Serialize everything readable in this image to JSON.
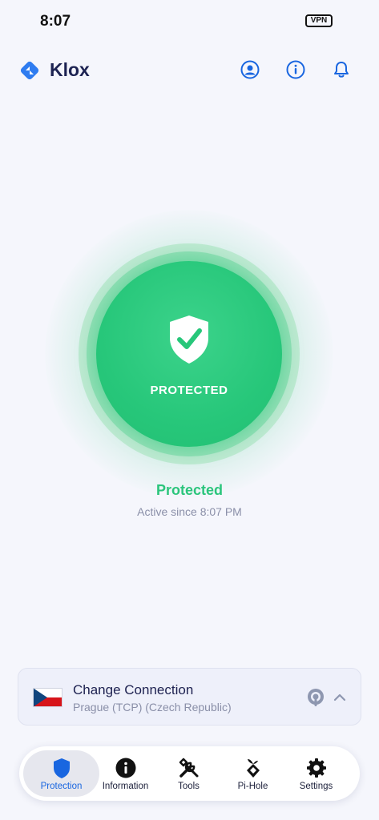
{
  "status_bar": {
    "time": "8:07",
    "vpn_badge": "VPN"
  },
  "header": {
    "app_name": "Klox",
    "icons": [
      "account-icon",
      "info-icon",
      "bell-icon"
    ]
  },
  "protection": {
    "circle_label": "PROTECTED",
    "status": "Protected",
    "since": "Active since 8:07 PM"
  },
  "connection": {
    "title": "Change Connection",
    "location": "Prague (TCP) (Czech Republic)",
    "flag": "czech-flag"
  },
  "tabs": [
    {
      "label": "Protection",
      "icon": "shield-icon",
      "active": true
    },
    {
      "label": "Information",
      "icon": "info-icon",
      "active": false
    },
    {
      "label": "Tools",
      "icon": "tools-icon",
      "active": false
    },
    {
      "label": "Pi-Hole",
      "icon": "pihole-icon",
      "active": false
    },
    {
      "label": "Settings",
      "icon": "gear-icon",
      "active": false
    }
  ],
  "colors": {
    "accent": "#1966e0",
    "protected_green": "#27c77a",
    "background": "#f5f6fc"
  }
}
